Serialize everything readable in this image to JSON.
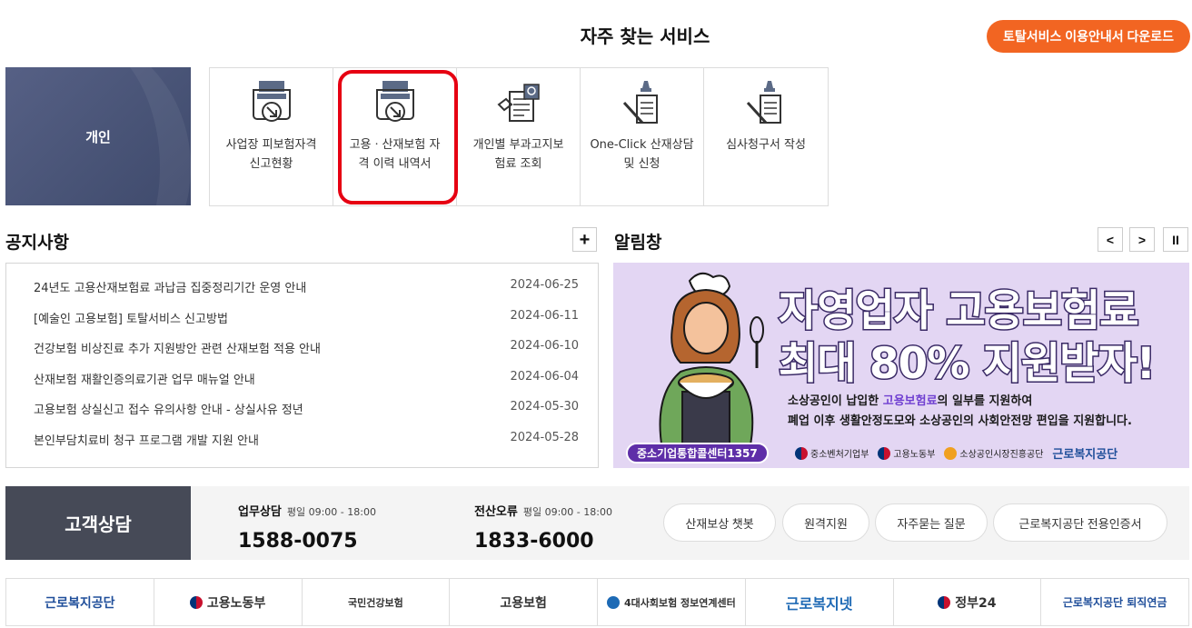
{
  "header": {
    "title": "자주 찾는 서비스",
    "download_label": "토탈서비스 이용안내서 다운로드"
  },
  "personal": {
    "label": "개인"
  },
  "services": [
    {
      "line1": "사업장 피보험자격",
      "line2": "신고현황",
      "icon": "document-arrow-icon"
    },
    {
      "line1": "고용ㆍ산재보험 자",
      "line2": "격 이력 내역서",
      "icon": "document-arrow-icon"
    },
    {
      "line1": "개인별 부과고지보",
      "line2": "험료 조회",
      "icon": "document-search-icon"
    },
    {
      "line1": "One-Click 산재상담",
      "line2": "및 신청",
      "icon": "pen-document-icon"
    },
    {
      "line1": "심사청구서 작성",
      "line2": "",
      "icon": "pen-document-icon"
    }
  ],
  "notice": {
    "title": "공지사항",
    "more_label": "+",
    "items": [
      {
        "title": "24년도 고용산재보험료 과납금 집중정리기간 운영 안내",
        "date": "2024-06-25"
      },
      {
        "title": "[예술인 고용보험] 토탈서비스 신고방법",
        "date": "2024-06-11"
      },
      {
        "title": "건강보험 비상진료 추가 지원방안 관련 산재보험 적용 안내",
        "date": "2024-06-10"
      },
      {
        "title": "산재보험 재활인증의료기관 업무 매뉴얼 안내",
        "date": "2024-06-04"
      },
      {
        "title": "고용보험 상실신고 접수 유의사항 안내 - 상실사유 정년",
        "date": "2024-05-30"
      },
      {
        "title": "본인부담치료비 청구 프로그램 개발 지원 안내",
        "date": "2024-05-28"
      }
    ]
  },
  "alert": {
    "title": "알림창",
    "prev": "<",
    "next": ">",
    "pause": "II",
    "banner": {
      "headline1": "자영업자 고용보험료",
      "headline2": "최대 80% 지원받자!",
      "sub1_pre": "소상공인이 납입한 ",
      "sub1_hl": "고용보험료",
      "sub1_post": "의 일부를 지원하여",
      "sub2": "폐업 이후 생활안정도모와 소상공인의 사회안전망 편입을 지원합니다.",
      "pill": "중소기업통합콜센터1357",
      "logos": [
        "중소벤처기업부",
        "고용노동부",
        "소상공인시장진흥공단",
        "근로복지공단"
      ]
    }
  },
  "support": {
    "title": "고객상담",
    "work": {
      "label": "업무상담",
      "hours": "평일 09:00 - 18:00",
      "phone": "1588-0075"
    },
    "it": {
      "label": "전산오류",
      "hours": "평일 09:00 - 18:00",
      "phone": "1833-6000"
    },
    "buttons": [
      "산재보상 챗봇",
      "원격지원",
      "자주묻는 질문",
      "근로복지공단 전용인증서"
    ]
  },
  "footer_links": [
    "근로복지공단",
    "고용노동부",
    "국민건강보험",
    "고용보험",
    "4대사회보험 정보연계센터",
    "근로복지넷",
    "정부24",
    "근로복지공단 퇴직연금"
  ],
  "colors": {
    "accent": "#f26522",
    "highlight": "#e60012",
    "navy": "#4a5578"
  }
}
